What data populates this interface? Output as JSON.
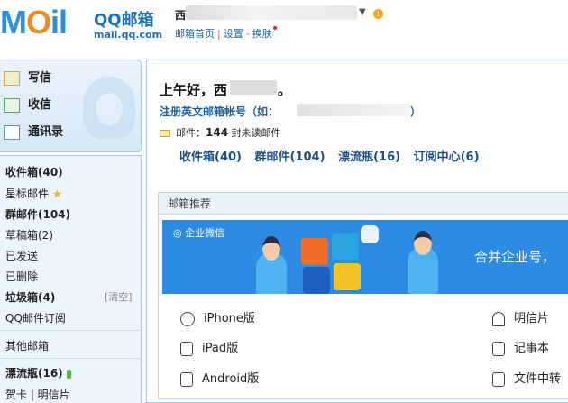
{
  "header": {
    "logo_word_a": "M",
    "logo_word_o": "O",
    "logo_word_b": "il",
    "logo_title": "QQ邮箱",
    "logo_url": "mail.qq.com",
    "user_name": "西",
    "top_links": [
      "邮箱首页",
      "设置",
      "换肤"
    ]
  },
  "actions": [
    {
      "label": "写信",
      "icon": "compose-icon"
    },
    {
      "label": "收信",
      "icon": "inbox-download-icon"
    },
    {
      "label": "通讯录",
      "icon": "address-book-icon"
    }
  ],
  "folders": [
    {
      "label": "收件箱(40)",
      "bold": true
    },
    {
      "label": "星标邮件",
      "bold": false,
      "star": true
    },
    {
      "label": "群邮件(104)",
      "bold": true
    },
    {
      "label": "草稿箱(2)",
      "bold": false
    },
    {
      "label": "已发送",
      "bold": false
    },
    {
      "label": "已删除",
      "bold": false
    },
    {
      "label": "垃圾箱(4)",
      "bold": true,
      "clear": "[清空]"
    },
    {
      "label": "QQ邮件订阅",
      "bold": false
    }
  ],
  "other_mailbox": "其他邮箱",
  "drift_bottle": "漂流瓶(16)",
  "cards_row": "贺卡 | 明信片",
  "main": {
    "greeting": "上午好，西",
    "greeting_tail": "。",
    "register_text": "注册英文邮箱帐号（如：",
    "register_tail": "）",
    "mail_label": "邮件：",
    "mail_count": "144",
    "mail_suffix": "封未读邮件",
    "quick_links": [
      "收件箱(40)",
      "群邮件(104)",
      "漂流瓶(16)",
      "订阅中心(6)"
    ]
  },
  "recommend": {
    "title": "邮箱推荐",
    "banner_label": "企业微信",
    "banner_text": "合并企业号，",
    "apps_left": [
      "iPhone版",
      "iPad版",
      "Android版"
    ],
    "apps_right": [
      "明信片",
      "记事本",
      "文件中转"
    ]
  },
  "colors": {
    "brand_blue": "#2d8fdc",
    "link_blue": "#1d5f9e",
    "banner_blue": "#2d8be4",
    "panel_bg": "#eef4fb"
  }
}
